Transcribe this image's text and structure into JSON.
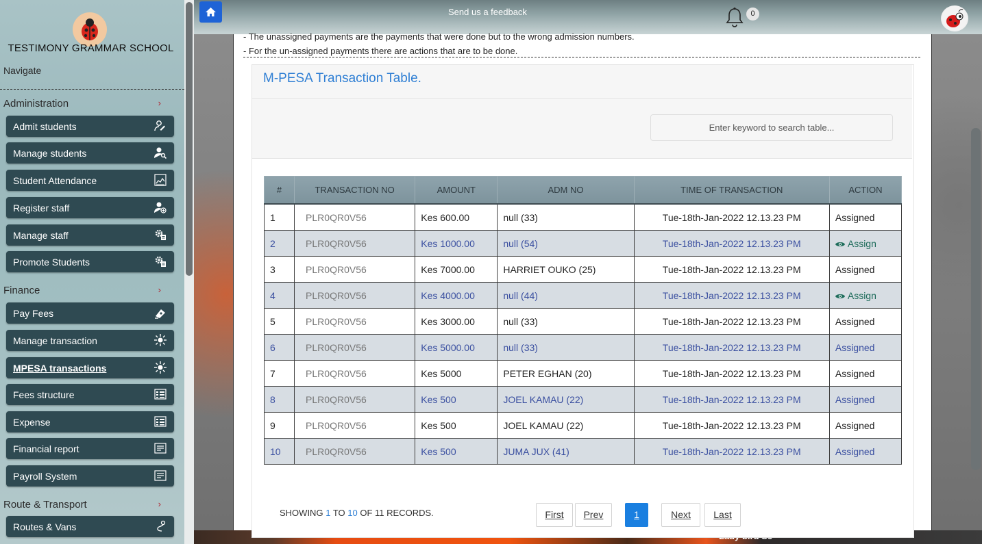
{
  "school": {
    "name": "TESTIMONY GRAMMAR SCHOOL"
  },
  "sidebar": {
    "navigate_label": "Navigate",
    "sections": [
      {
        "label": "Administration"
      },
      {
        "label": "Finance"
      },
      {
        "label": "Route & Transport"
      }
    ],
    "items": [
      {
        "label": "Admit students",
        "icon": "person-edit-icon"
      },
      {
        "label": "Manage students",
        "icon": "person-search-icon"
      },
      {
        "label": "Student Attendance",
        "icon": "attendance-icon"
      },
      {
        "label": "Register staff",
        "icon": "person-add-icon"
      },
      {
        "label": "Manage staff",
        "icon": "gear-doc-icon"
      },
      {
        "label": "Promote Students",
        "icon": "gear-doc-icon"
      },
      {
        "label": "Pay Fees",
        "icon": "money-icon"
      },
      {
        "label": "Manage transaction",
        "icon": "burst-icon"
      },
      {
        "label": "MPESA transactions",
        "icon": "burst-icon"
      },
      {
        "label": "Fees structure",
        "icon": "table-icon"
      },
      {
        "label": "Expense",
        "icon": "table-icon"
      },
      {
        "label": "Financial report",
        "icon": "report-icon"
      },
      {
        "label": "Payroll System",
        "icon": "report-icon"
      },
      {
        "label": "Routes & Vans",
        "icon": "route-icon"
      }
    ]
  },
  "header": {
    "feedback": "Send us a feedback",
    "notification_count": "0"
  },
  "notes": [
    "- The unassigned payments are the payments that were done but to the wrong admission numbers.",
    "- For the un-assigned payments there are actions that are to be done."
  ],
  "card": {
    "title": "M-PESA Transaction Table.",
    "search_placeholder": "Enter keyword to search table..."
  },
  "table": {
    "columns": [
      "#",
      "TRANSACTION NO",
      "AMOUNT",
      "ADM NO",
      "TIME OF TRANSACTION",
      "ACTION"
    ],
    "rows": [
      {
        "n": "1",
        "tx": "PLR0QR0V56",
        "amount": "Kes 600.00",
        "adm": "null (33)",
        "time": "Tue-18th-Jan-2022 12.13.23 PM",
        "action": "Assigned"
      },
      {
        "n": "2",
        "tx": "PLR0QR0V56",
        "amount": "Kes 1000.00",
        "adm": "null (54)",
        "time": "Tue-18th-Jan-2022 12.13.23 PM",
        "action": "Assign"
      },
      {
        "n": "3",
        "tx": "PLR0QR0V56",
        "amount": "Kes 7000.00",
        "adm": "HARRIET OUKO (25)",
        "time": "Tue-18th-Jan-2022 12.13.23 PM",
        "action": "Assigned"
      },
      {
        "n": "4",
        "tx": "PLR0QR0V56",
        "amount": "Kes 4000.00",
        "adm": "null (44)",
        "time": "Tue-18th-Jan-2022 12.13.23 PM",
        "action": "Assign"
      },
      {
        "n": "5",
        "tx": "PLR0QR0V56",
        "amount": "Kes 3000.00",
        "adm": "null (33)",
        "time": "Tue-18th-Jan-2022 12.13.23 PM",
        "action": "Assigned"
      },
      {
        "n": "6",
        "tx": "PLR0QR0V56",
        "amount": "Kes 5000.00",
        "adm": "null (33)",
        "time": "Tue-18th-Jan-2022 12.13.23 PM",
        "action": "Assigned"
      },
      {
        "n": "7",
        "tx": "PLR0QR0V56",
        "amount": "Kes 5000",
        "adm": "PETER EGHAN (20)",
        "time": "Tue-18th-Jan-2022 12.13.23 PM",
        "action": "Assigned"
      },
      {
        "n": "8",
        "tx": "PLR0QR0V56",
        "amount": "Kes 500",
        "adm": "JOEL KAMAU (22)",
        "time": "Tue-18th-Jan-2022 12.13.23 PM",
        "action": "Assigned"
      },
      {
        "n": "9",
        "tx": "PLR0QR0V56",
        "amount": "Kes 500",
        "adm": "JOEL KAMAU (22)",
        "time": "Tue-18th-Jan-2022 12.13.23 PM",
        "action": "Assigned"
      },
      {
        "n": "10",
        "tx": "PLR0QR0V56",
        "amount": "Kes 500",
        "adm": "JUMA JUX (41)",
        "time": "Tue-18th-Jan-2022 12.13.23 PM",
        "action": "Assigned"
      }
    ]
  },
  "pagination": {
    "showing_prefix": "SHOWING",
    "from": "1",
    "to_word": "TO",
    "to": "10",
    "of_text": "OF 11 RECORDS.",
    "first": "First",
    "prev": "Prev",
    "current": "1",
    "next": "Next",
    "last": "Last"
  },
  "footer_caption": "Lady bird Sc",
  "colors": {
    "accent": "#1a7fe0",
    "sidebar_button": "#2f4a52",
    "title_blue": "#2f7fd4",
    "alt_row": "#d7dde3"
  }
}
